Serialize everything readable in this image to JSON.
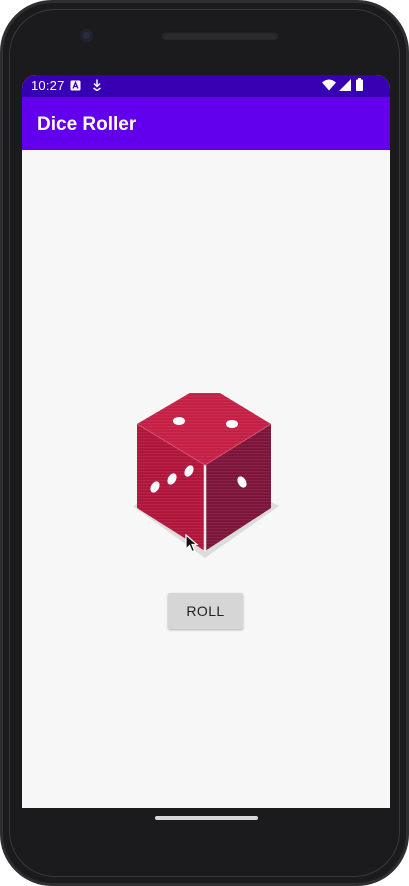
{
  "status_bar": {
    "time": "10:27",
    "left_icons": [
      "a-notification-icon",
      "download-icon"
    ],
    "right_icons": [
      "wifi-icon",
      "signal-icon",
      "battery-icon"
    ],
    "color": "#3700b3"
  },
  "app_bar": {
    "title": "Dice Roller",
    "color": "#6200ee"
  },
  "dice": {
    "top_face_pips": 2,
    "left_face_pips": 3,
    "right_face_pips": 1,
    "color": "#b0143a"
  },
  "roll_button": {
    "label": "ROLL"
  }
}
